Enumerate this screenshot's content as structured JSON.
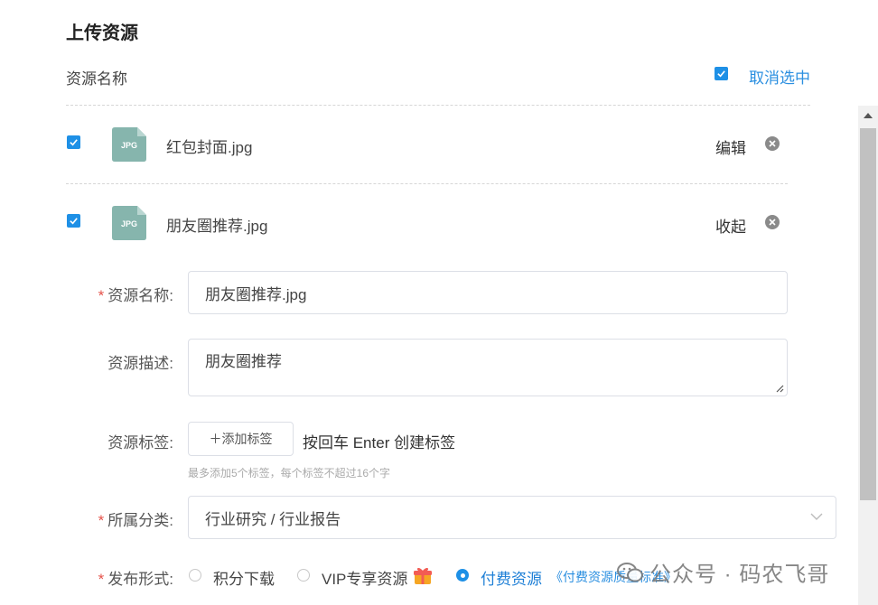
{
  "page": {
    "title": "上传资源",
    "list_header": {
      "label": "资源名称",
      "deselect_label": "取消选中"
    }
  },
  "files": [
    {
      "name": "红包封面.jpg",
      "type_label": "JPG",
      "action": "编辑",
      "checked": true
    },
    {
      "name": "朋友圈推荐.jpg",
      "type_label": "JPG",
      "action": "收起",
      "checked": true
    }
  ],
  "form": {
    "name": {
      "label": "资源名称:",
      "required": "*",
      "value": "朋友圈推荐.jpg"
    },
    "description": {
      "label": "资源描述:",
      "value": "朋友圈推荐"
    },
    "tags": {
      "label": "资源标签:",
      "add_button": "＋添加标签",
      "hint": "按回车 Enter 创建标签",
      "note": "最多添加5个标签，每个标签不超过16个字"
    },
    "category": {
      "label": "所属分类:",
      "required": "*",
      "value": "行业研究 / 行业报告"
    },
    "publish": {
      "label": "发布形式:",
      "required": "*",
      "options": [
        "积分下载",
        "VIP专享资源",
        "付费资源"
      ],
      "selected": "付费资源",
      "standard_link": "《付费资源质量标准》"
    }
  },
  "watermark": {
    "text": "公众号 · 码农飞哥"
  },
  "colors": {
    "accent": "#1e90e6",
    "link": "#2b8fe0",
    "required": "#e5534b",
    "file_icon": "#86b5ad"
  }
}
